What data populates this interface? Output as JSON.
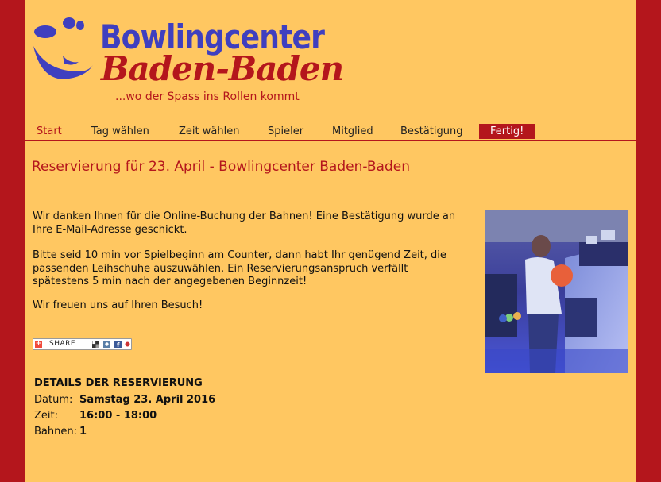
{
  "header": {
    "title": "Bowlingcenter",
    "subtitle": "Baden-Baden",
    "tagline": "...wo der Spass ins Rollen kommt"
  },
  "nav": {
    "items": [
      {
        "label": "Start"
      },
      {
        "label": "Tag wählen"
      },
      {
        "label": "Zeit wählen"
      },
      {
        "label": "Spieler"
      },
      {
        "label": "Mitglied"
      },
      {
        "label": "Bestätigung"
      },
      {
        "label": "Fertig!"
      }
    ]
  },
  "main": {
    "heading": "Reservierung für 23. April - Bowlingcenter Baden-Baden",
    "paragraph1": "Wir danken Ihnen für die Online-Buchung der Bahnen! Eine Bestätigung wurde an Ihre E-Mail-Adresse geschickt.",
    "paragraph2": "Bitte seid 10 min vor Spielbeginn am Counter, dann habt Ihr genügend Zeit, die passenden Leihschuhe auszuwählen. Ein Reservierungsanspruch verfällt spätestens 5 min nach der angegebenen Beginnzeit!",
    "paragraph3": "Wir freuen uns auf Ihren Besuch!",
    "share_label": "SHARE"
  },
  "details": {
    "title": "DETAILS DER RESERVIERUNG",
    "date_label": "Datum:",
    "date_value": "Samstag 23. April 2016",
    "time_label": "Zeit:",
    "time_value": "16:00 - 18:00",
    "lanes_label": "Bahnen:",
    "lanes_value": "1"
  },
  "colors": {
    "brand_red": "#b4161c",
    "brand_blue": "#3f3fbf",
    "background": "#ffc761"
  }
}
